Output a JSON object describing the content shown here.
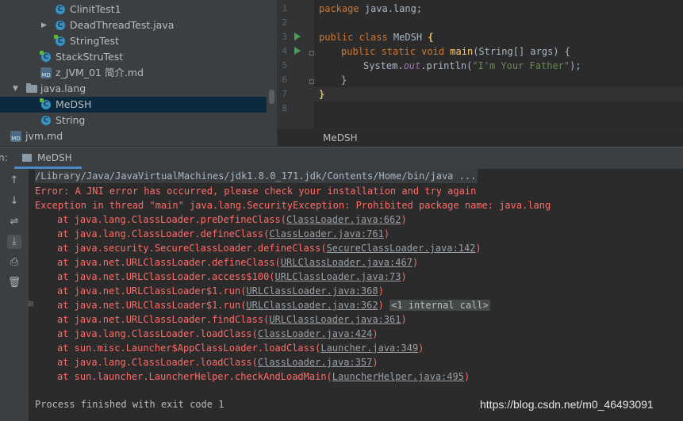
{
  "project_tree": {
    "items": [
      {
        "label": "ClinitTest1",
        "icon": "java-class-icon"
      },
      {
        "label": "DeadThreadTest.java",
        "icon": "java-class-icon"
      },
      {
        "label": "StringTest",
        "icon": "java-class-icon"
      },
      {
        "label": "StackStruTest",
        "icon": "java-class-icon"
      },
      {
        "label": "z_JVM_01 简介.md",
        "icon": "markdown-file-icon"
      },
      {
        "label": "java.lang",
        "icon": "package-folder-icon"
      },
      {
        "label": "MeDSH",
        "icon": "java-class-icon"
      },
      {
        "label": "String",
        "icon": "java-class-icon"
      },
      {
        "label": "jvm.md",
        "icon": "markdown-file-icon"
      }
    ]
  },
  "editor": {
    "line_numbers": [
      "1",
      "2",
      "3",
      "4",
      "5",
      "6",
      "7",
      "8"
    ],
    "code": {
      "line1": {
        "kw": "package",
        "rest": " java.lang;"
      },
      "line3": {
        "kw": "public class",
        "name": " MeDSH ",
        "brace": "{"
      },
      "line4": {
        "kw": "public static void",
        "method": "main",
        "rest": "(String[] args) {"
      },
      "line5": {
        "pre": "System.",
        "field": "out",
        "mid": ".println(",
        "str": "\"I'm Your Father\"",
        "post": ");"
      },
      "line6": "}",
      "line7": "}"
    },
    "breadcrumb": "MeDSH"
  },
  "run": {
    "label": "n:",
    "tab": "MeDSH",
    "output": {
      "command": "/Library/Java/JavaVirtualMachines/jdk1.8.0_171.jdk/Contents/Home/bin/java ...",
      "error1": "Error: A JNI error has occurred, please check your installation and try again",
      "error2": "Exception in thread \"main\" java.lang.SecurityException: Prohibited package name: java.lang",
      "stack": [
        {
          "pre": "at java.lang.ClassLoader.preDefineClass(",
          "link": "ClassLoader.java:662",
          "post": ")"
        },
        {
          "pre": "at java.lang.ClassLoader.defineClass(",
          "link": "ClassLoader.java:761",
          "post": ")"
        },
        {
          "pre": "at java.security.SecureClassLoader.defineClass(",
          "link": "SecureClassLoader.java:142",
          "post": ")"
        },
        {
          "pre": "at java.net.URLClassLoader.defineClass(",
          "link": "URLClassLoader.java:467",
          "post": ")"
        },
        {
          "pre": "at java.net.URLClassLoader.access$100(",
          "link": "URLClassLoader.java:73",
          "post": ")"
        },
        {
          "pre": "at java.net.URLClassLoader$1.run(",
          "link": "URLClassLoader.java:368",
          "post": ")"
        },
        {
          "pre": "at java.net.URLClassLoader$1.run(",
          "link": "URLClassLoader.java:362",
          "post": ")",
          "note": "<1 internal call>"
        },
        {
          "pre": "at java.net.URLClassLoader.findClass(",
          "link": "URLClassLoader.java:361",
          "post": ")"
        },
        {
          "pre": "at java.lang.ClassLoader.loadClass(",
          "link": "ClassLoader.java:424",
          "post": ")"
        },
        {
          "pre": "at sun.misc.Launcher$AppClassLoader.loadClass(",
          "link": "Launcher.java:349",
          "post": ")"
        },
        {
          "pre": "at java.lang.ClassLoader.loadClass(",
          "link": "ClassLoader.java:357",
          "post": ")"
        },
        {
          "pre": "at sun.launcher.LauncherHelper.checkAndLoadMain(",
          "link": "LauncherHelper.java:495",
          "post": ")"
        }
      ],
      "finished": "Process finished with exit code 1"
    }
  },
  "watermark": "https://blog.csdn.net/m0_46493091",
  "colors": {
    "error": "#ff6b68",
    "keyword": "#cc7832",
    "string": "#6a8759",
    "selection": "#0d293e",
    "tab_underline": "#4a88c7"
  }
}
